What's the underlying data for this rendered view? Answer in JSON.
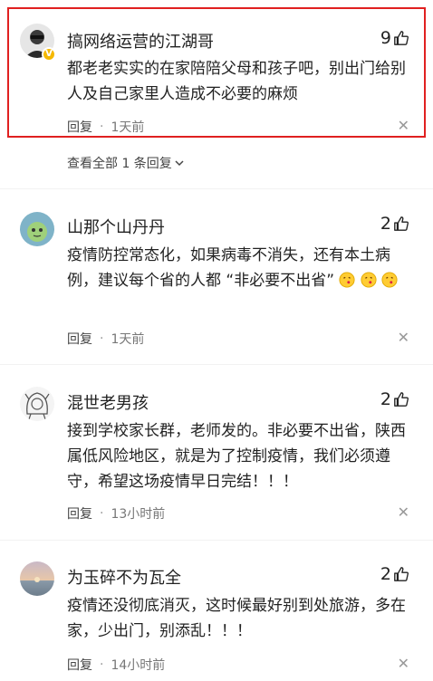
{
  "comments": [
    {
      "name": "搞网络运营的江湖哥",
      "likes": "9",
      "text": "都老老实实的在家陪陪父母和孩子吧，别出门给别人及自己家里人造成不必要的麻烦",
      "reply_label": "回复",
      "time": "1天前"
    },
    {
      "name": "山那个山丹丹",
      "likes": "2",
      "text_before_emoji": "疫情防控常态化，如果病毒不消失，还有本土病例，建议每个省的人都 “非必要不出省”",
      "reply_label": "回复",
      "time": "1天前"
    },
    {
      "name": "混世老男孩",
      "likes": "2",
      "text": "接到学校家长群，老师发的。非必要不出省，陕西属低风险地区，就是为了控制疫情，我们必须遵守，希望这场疫情早日完结！！！",
      "reply_label": "回复",
      "time": "13小时前"
    },
    {
      "name": "为玉碎不为瓦全",
      "likes": "2",
      "text": "疫情还没彻底消灭，这时候最好别到处旅游，多在家，少出门，别添乱！！！",
      "reply_label": "回复",
      "time": "14小时前"
    }
  ],
  "view_all": {
    "label": "查看全部 1 条回复"
  },
  "icons": {
    "like": "thumbs-up-icon",
    "close": "close-icon",
    "chevron": "chevron-down-icon",
    "verified": "verified-badge-icon"
  },
  "colors": {
    "highlight_border": "#e02020",
    "verified": "#f5b800",
    "meta_text": "#777777"
  }
}
